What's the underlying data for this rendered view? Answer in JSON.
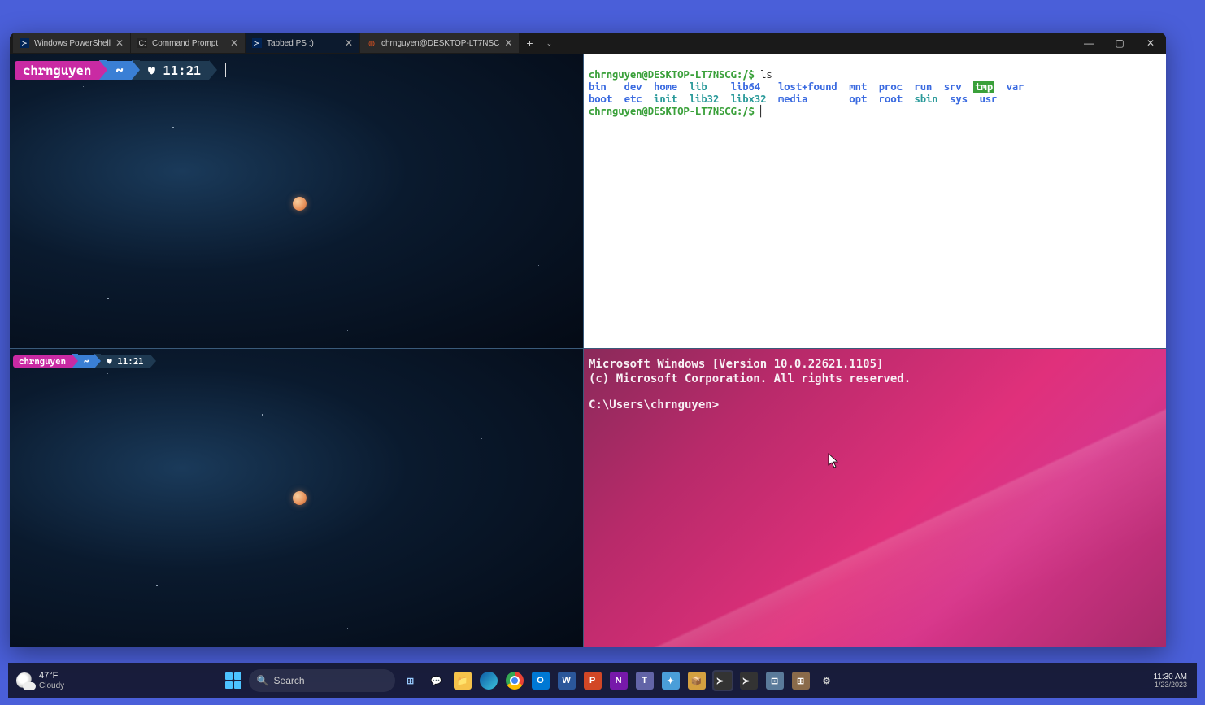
{
  "tabs": [
    {
      "icon": "ps-icon",
      "label": "Windows PowerShell"
    },
    {
      "icon": "cmd-icon",
      "label": "Command Prompt"
    },
    {
      "icon": "ps-icon",
      "label": "Tabbed PS :)"
    },
    {
      "icon": "ubuntu-icon",
      "label": "chrnguyen@DESKTOP-LT7NSC"
    }
  ],
  "window_controls": {
    "min": "—",
    "max": "▢",
    "close": "✕"
  },
  "ps_prompt": {
    "user": "chrnguyen",
    "tilde": "~",
    "heart": "♥",
    "time": "11:21"
  },
  "ubuntu": {
    "prompt1": "chrnguyen@DESKTOP-LT7NSCG:/$",
    "cmd1": "ls",
    "row1": [
      "bin",
      "dev",
      "home",
      "lib",
      "lib64",
      "lost+found",
      "mnt",
      "proc",
      "run",
      "srv",
      "tmp",
      "var"
    ],
    "row2": [
      "boot",
      "etc",
      "init",
      "lib32",
      "libx32",
      "media",
      "",
      "opt",
      "root",
      "sbin",
      "sys",
      "usr"
    ],
    "prompt2": "chrnguyen@DESKTOP-LT7NSCG:/$"
  },
  "cmd": {
    "line1": "Microsoft Windows [Version 10.0.22621.1105]",
    "line2": "(c) Microsoft Corporation. All rights reserved.",
    "prompt": "C:\\Users\\chrnguyen>"
  },
  "taskbar": {
    "weather_temp": "47°F",
    "weather_label": "Cloudy",
    "search_label": "Search",
    "time": "11:30 AM",
    "date": "1/23/2023",
    "apps": [
      "task-view",
      "chat",
      "explorer",
      "edge",
      "chrome",
      "outlook",
      "word",
      "powerpoint",
      "onenote",
      "teams",
      "vscode",
      "terminal-active",
      "terminal",
      "files",
      "store",
      "settings"
    ]
  }
}
